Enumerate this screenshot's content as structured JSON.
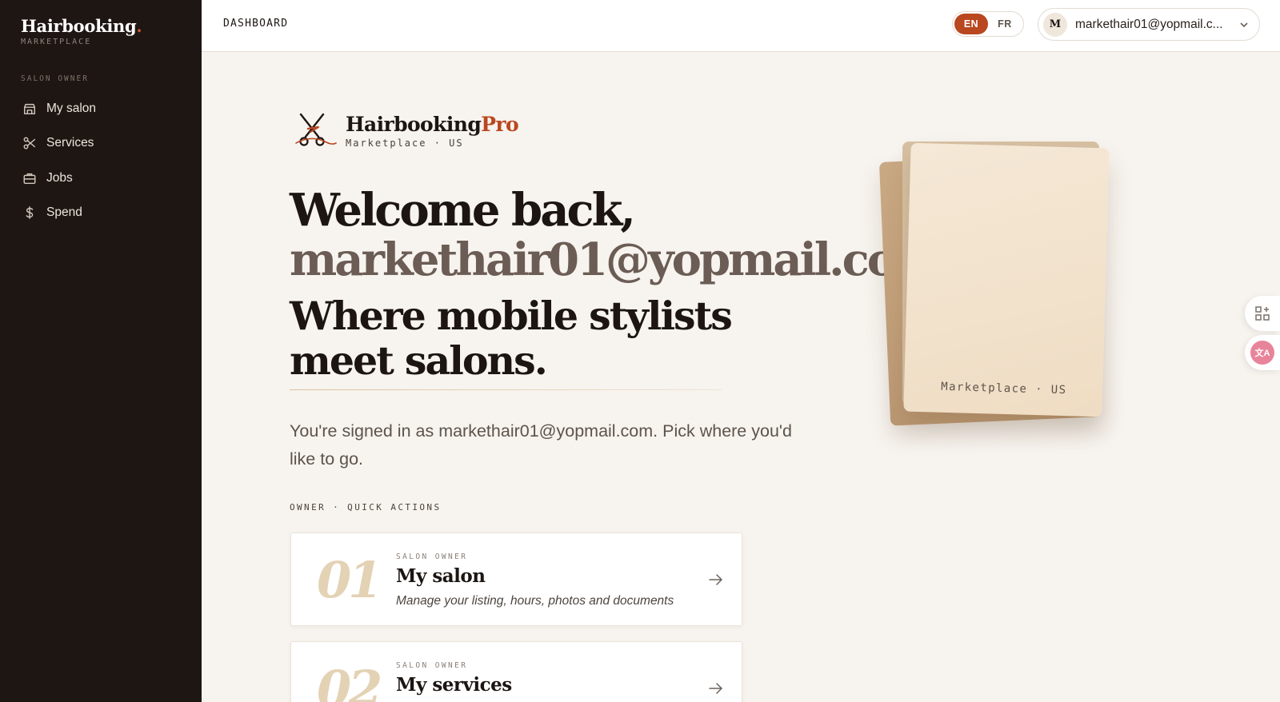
{
  "sidebar": {
    "brand_name": "Hairbooking",
    "brand_dot": ".",
    "brand_sub": "MARKETPLACE",
    "section_label": "SALON OWNER",
    "items": [
      {
        "label": "My salon",
        "icon": "store-icon"
      },
      {
        "label": "Services",
        "icon": "scissors-icon"
      },
      {
        "label": "Jobs",
        "icon": "briefcase-icon"
      },
      {
        "label": "Spend",
        "icon": "dollar-icon"
      }
    ]
  },
  "header": {
    "title": "DASHBOARD",
    "languages": [
      "EN",
      "FR"
    ],
    "active_language": "EN",
    "account_initial": "M",
    "account_email": "markethair01@yopmail.c..."
  },
  "hero": {
    "logo_name": "Hairbooking",
    "logo_pro": "Pro",
    "logo_sub": "Marketplace · US",
    "welcome": "Welcome back,",
    "email": "markethair01@yopmail.com",
    "tagline": "Where mobile stylists meet salons.",
    "lead": "You're signed in as markethair01@yopmail.com. Pick where you'd like to go.",
    "illustration_label": "Marketplace · US"
  },
  "quick_actions": {
    "label": "OWNER · QUICK ACTIONS",
    "cards": [
      {
        "num": "01",
        "eyebrow": "SALON OWNER",
        "title": "My salon",
        "desc": "Manage your listing, hours, photos and documents"
      },
      {
        "num": "02",
        "eyebrow": "SALON OWNER",
        "title": "My services",
        "desc": ""
      }
    ]
  },
  "colors": {
    "sidebar_bg": "#1e1613",
    "accent": "#b9471f",
    "page_bg": "#f7f3ee"
  }
}
